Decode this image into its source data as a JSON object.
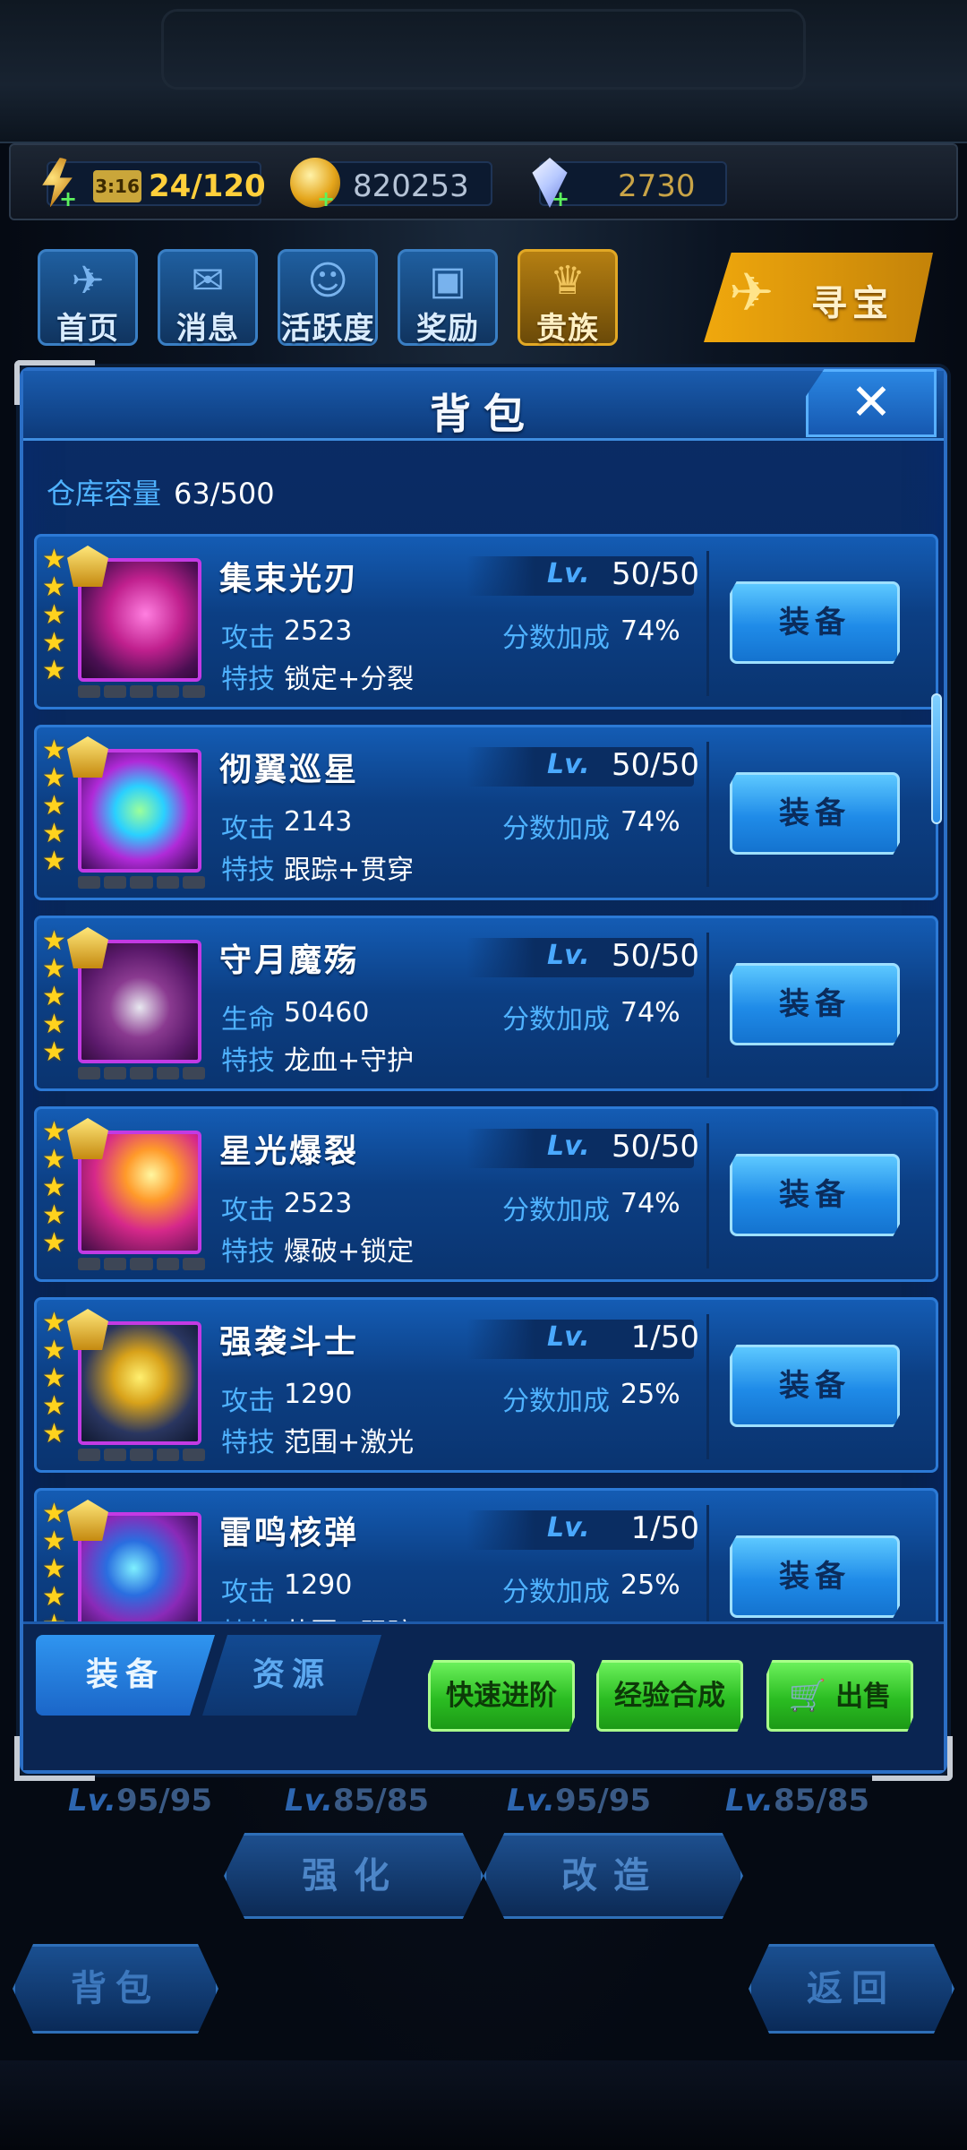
{
  "resources": {
    "energy_timer": "3:16",
    "energy": "24/120",
    "coins": "820253",
    "gems": "2730"
  },
  "nav": [
    {
      "label": "首页",
      "icon": "jet-icon"
    },
    {
      "label": "消息",
      "icon": "mail-icon"
    },
    {
      "label": "活跃度",
      "icon": "smile-badge-icon"
    },
    {
      "label": "奖励",
      "icon": "gift-icon"
    },
    {
      "label": "贵族",
      "icon": "vip-emblem-icon"
    }
  ],
  "treasure_label": "寻宝",
  "panel": {
    "title": "背包",
    "capacity_label": "仓库容量",
    "capacity_value": "63/500"
  },
  "items": [
    {
      "name": "集束光刃",
      "lv_tag": "Lv.",
      "level": "50/50",
      "stat_label": "攻击",
      "stat_value": "2523",
      "bonus_label": "分数加成",
      "bonus_value": "74%",
      "skill_label": "特技",
      "skill_value": "锁定+分裂",
      "button": "装备",
      "stars": 5
    },
    {
      "name": "彻翼巡星",
      "lv_tag": "Lv.",
      "level": "50/50",
      "stat_label": "攻击",
      "stat_value": "2143",
      "bonus_label": "分数加成",
      "bonus_value": "74%",
      "skill_label": "特技",
      "skill_value": "跟踪+贯穿",
      "button": "装备",
      "stars": 5
    },
    {
      "name": "守月魔殇",
      "lv_tag": "Lv.",
      "level": "50/50",
      "stat_label": "生命",
      "stat_value": "50460",
      "bonus_label": "分数加成",
      "bonus_value": "74%",
      "skill_label": "特技",
      "skill_value": "龙血+守护",
      "button": "装备",
      "stars": 5
    },
    {
      "name": "星光爆裂",
      "lv_tag": "Lv.",
      "level": "50/50",
      "stat_label": "攻击",
      "stat_value": "2523",
      "bonus_label": "分数加成",
      "bonus_value": "74%",
      "skill_label": "特技",
      "skill_value": "爆破+锁定",
      "button": "装备",
      "stars": 5
    },
    {
      "name": "强袭斗士",
      "lv_tag": "Lv.",
      "level": "1/50",
      "stat_label": "攻击",
      "stat_value": "1290",
      "bonus_label": "分数加成",
      "bonus_value": "25%",
      "skill_label": "特技",
      "skill_value": "范围+激光",
      "button": "装备",
      "stars": 5
    },
    {
      "name": "雷鸣核弹",
      "lv_tag": "Lv.",
      "level": "1/50",
      "stat_label": "攻击",
      "stat_value": "1290",
      "bonus_label": "分数加成",
      "bonus_value": "25%",
      "skill_label": "特技",
      "skill_value": "范围+跟踪",
      "button": "装备",
      "stars": 5
    }
  ],
  "tabs": {
    "equip": "装备",
    "resource": "资源"
  },
  "actions": {
    "quick_advance": "快速进阶",
    "exp_merge": "经验合成",
    "sell": "出售"
  },
  "background": {
    "levels": [
      {
        "tag": "Lv.",
        "value": "95/95"
      },
      {
        "tag": "Lv.",
        "value": "85/85"
      },
      {
        "tag": "Lv.",
        "value": "95/95"
      },
      {
        "tag": "Lv.",
        "value": "85/85"
      }
    ],
    "enhance": "强化",
    "modify": "改造",
    "bag": "背包",
    "back": "返回"
  },
  "colors": {
    "panel_bg": "#082656",
    "accent_blue": "#4fb2ff",
    "equip_button": "#1f8be8",
    "action_green": "#2bbd22",
    "gold": "#f0a80d"
  }
}
